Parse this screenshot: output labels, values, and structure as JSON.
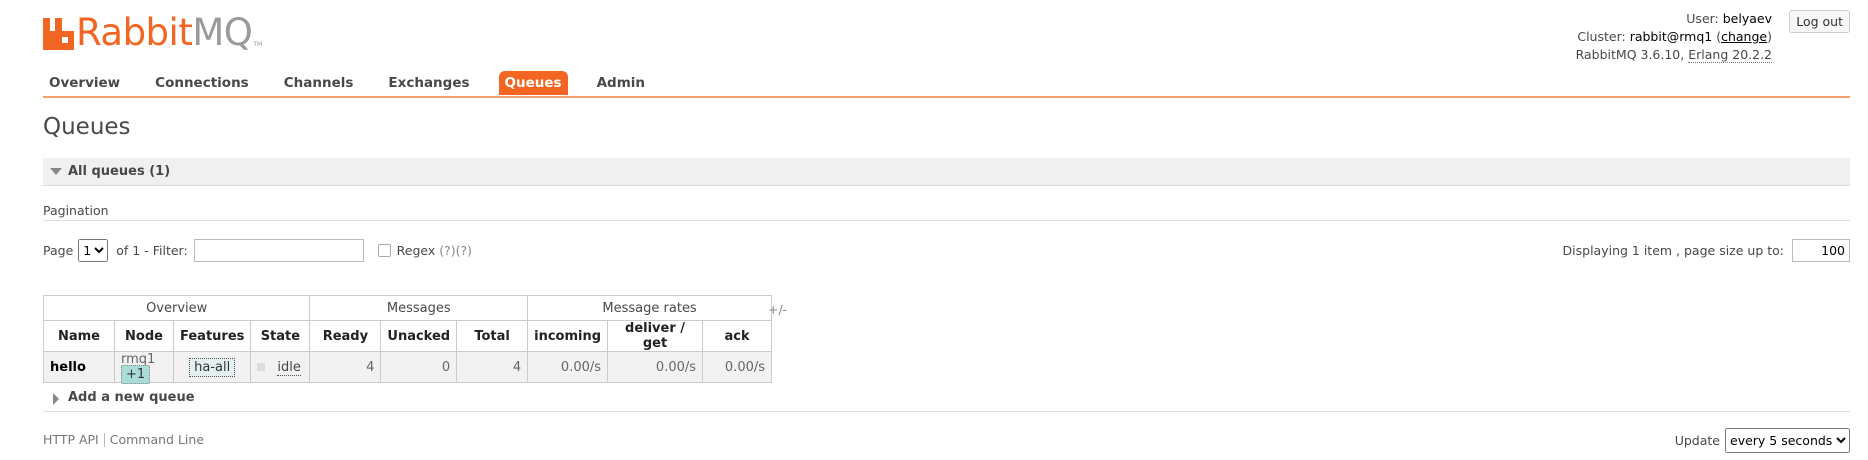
{
  "header": {
    "logo_primary": "Rabbit",
    "logo_secondary": "MQ",
    "logo_tm": "TM",
    "user_label": "User:",
    "user_value": "belyaev",
    "cluster_label": "Cluster:",
    "cluster_value": "rabbit@rmq1",
    "change_link": "change",
    "version_text": "RabbitMQ 3.6.10,",
    "erlang_text": "Erlang 20.2.2",
    "logout_label": "Log out"
  },
  "tabs": [
    {
      "label": "Overview"
    },
    {
      "label": "Connections"
    },
    {
      "label": "Channels"
    },
    {
      "label": "Exchanges"
    },
    {
      "label": "Queues",
      "active": true
    },
    {
      "label": "Admin"
    }
  ],
  "page": {
    "title": "Queues",
    "all_queues_label": "All queues (1)",
    "pagination_label": "Pagination",
    "page_label": "Page",
    "page_value": "1",
    "of_label": "of 1",
    "filter_label": "- Filter:",
    "filter_value": "",
    "regex_label": "Regex",
    "regex_help": "(?)(?)",
    "displaying_text": "Displaying 1 item , page size up to:",
    "page_size_value": "100"
  },
  "table": {
    "groups": [
      "Overview",
      "Messages",
      "Message rates"
    ],
    "plus_minus": "+/-",
    "columns": [
      "Name",
      "Node",
      "Features",
      "State",
      "Ready",
      "Unacked",
      "Total",
      "incoming",
      "deliver / get",
      "ack"
    ],
    "rows": [
      {
        "name": "hello",
        "node": "rmq1",
        "node_badge": "+1",
        "features": "ha-all",
        "state": "idle",
        "ready": "4",
        "unacked": "0",
        "total": "4",
        "incoming": "0.00/s",
        "deliver_get": "0.00/s",
        "ack": "0.00/s"
      }
    ]
  },
  "add_queue_label": "Add a new queue",
  "footer": {
    "http_api": "HTTP API",
    "command_line": "Command Line",
    "update_label": "Update",
    "update_value": "every 5 seconds"
  },
  "colors": {
    "accent": "#f26522",
    "logo_grey": "#9a9a9a"
  }
}
